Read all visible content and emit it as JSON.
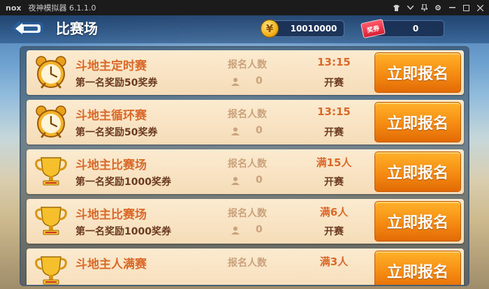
{
  "emulator": {
    "logo": "nox",
    "title": "夜神模拟器 6.1.1.0"
  },
  "header": {
    "title": "比赛场",
    "gold": "10010000",
    "ticket_label": "奖券",
    "tickets": "0"
  },
  "matches": [
    {
      "name": "斗地主定时赛",
      "prize": "第一名奖励50奖券",
      "count_label": "报名人数",
      "count": "0",
      "time": "13:15",
      "status": "开赛",
      "button": "立即报名",
      "icon": "alarm-clock-icon"
    },
    {
      "name": "斗地主循环赛",
      "prize": "第一名奖励50奖券",
      "count_label": "报名人数",
      "count": "0",
      "time": "13:15",
      "status": "开赛",
      "button": "立即报名",
      "icon": "alarm-clock-icon"
    },
    {
      "name": "斗地主比赛场",
      "prize": "第一名奖励1000奖券",
      "count_label": "报名人数",
      "count": "0",
      "time": "满15人",
      "status": "开赛",
      "button": "立即报名",
      "icon": "trophy-icon"
    },
    {
      "name": "斗地主比赛场",
      "prize": "第一名奖励1000奖券",
      "count_label": "报名人数",
      "count": "0",
      "time": "满6人",
      "status": "开赛",
      "button": "立即报名",
      "icon": "trophy-icon"
    },
    {
      "name": "斗地主人满赛",
      "prize": "",
      "count_label": "报名人数",
      "count": "",
      "time": "满3人",
      "status": "",
      "button": "立即报名",
      "icon": "trophy-icon"
    }
  ],
  "colors": {
    "accent_orange": "#f58b12",
    "row_bg": "#fcebd0",
    "title_text": "#d9692a"
  }
}
